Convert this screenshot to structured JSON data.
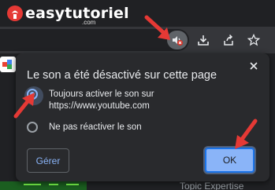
{
  "watermark": {
    "logo_text": "easytutoriel",
    "logo_sub": ".com"
  },
  "toolbar": {
    "mute_icon": "muted-speaker-icon",
    "download_icon": "download-icon",
    "share_icon": "share-icon",
    "bookmark_icon": "star-icon"
  },
  "popup": {
    "title": "Le son a été désactivé sur cette page",
    "options": [
      {
        "label": "Toujours activer le son sur https://www.youtube.com",
        "checked": true
      },
      {
        "label": "Ne pas réactiver le son",
        "checked": false
      }
    ],
    "manage_label": "Gérer",
    "ok_label": "OK"
  },
  "background": {
    "bottom_text": "Topic Expertise",
    "right_text": "e"
  },
  "colors": {
    "accent": "#8ab4f8",
    "popup_bg": "#292a2d",
    "annotation": "#e53935"
  }
}
